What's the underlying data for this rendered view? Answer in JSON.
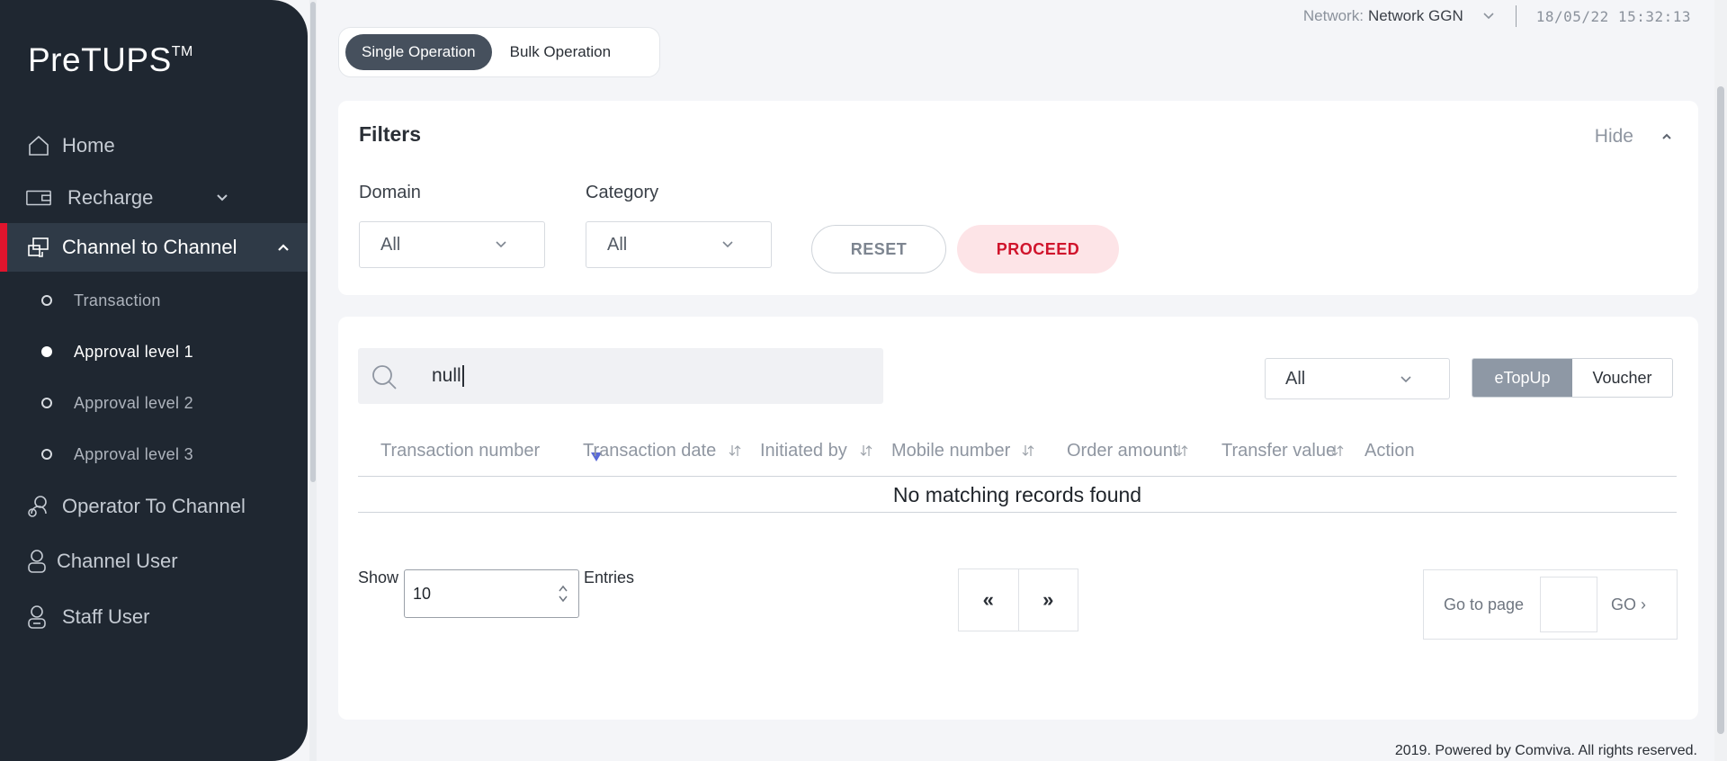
{
  "app": {
    "logo_text": "PreTUPS",
    "logo_mark": "TM"
  },
  "sidebar": {
    "items": [
      {
        "label": "Home",
        "icon": "home-icon"
      },
      {
        "label": "Recharge",
        "icon": "wallet-icon"
      },
      {
        "label": "Channel to Channel",
        "icon": "transfer-icon",
        "active": true
      },
      {
        "label": "Operator To Channel",
        "icon": "operator-icon"
      },
      {
        "label": "Channel User",
        "icon": "user-icon"
      },
      {
        "label": "Staff User",
        "icon": "staff-icon"
      }
    ],
    "subitems": [
      {
        "label": "Transaction"
      },
      {
        "label": "Approval level 1",
        "current": true
      },
      {
        "label": "Approval level 2"
      },
      {
        "label": "Approval level 3"
      }
    ]
  },
  "header": {
    "network_label": "Network:",
    "network_value": "Network GGN",
    "datetime": "18/05/22 15:32:13"
  },
  "tabs": {
    "single": "Single Operation",
    "bulk": "Bulk Operation"
  },
  "filters": {
    "title": "Filters",
    "hide_label": "Hide",
    "domain_label": "Domain",
    "domain_value": "All",
    "category_label": "Category",
    "category_value": "All",
    "reset_label": "RESET",
    "proceed_label": "PROCEED"
  },
  "results": {
    "search_value": "null",
    "type_value": "All",
    "segments": {
      "etopup": "eTopUp",
      "voucher": "Voucher"
    },
    "columns": [
      "Transaction number",
      "Transaction date",
      "Initiated by",
      "Mobile number",
      "Order amount",
      "Transfer value",
      "Action"
    ],
    "empty_text": "No matching records found",
    "show_label": "Show",
    "entries_value": "10",
    "entries_label": "Entries",
    "prev_label": "«",
    "next_label": "»",
    "goto_label": "Go to page",
    "go_label": "GO ›"
  },
  "footer": {
    "text": "2019. Powered by Comviva. All rights reserved."
  },
  "colors": {
    "sidebar_bg": "#1f2731",
    "accent_red": "#e0142d",
    "proceed_bg": "#fde4e7",
    "segment_on": "#8e98a5"
  }
}
